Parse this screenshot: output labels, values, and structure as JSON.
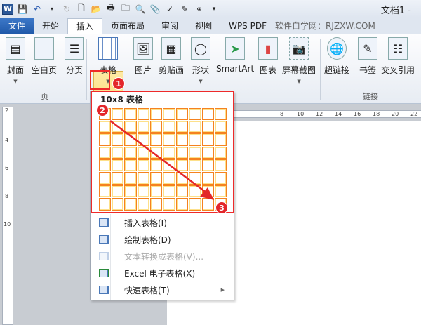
{
  "window": {
    "title": "文档1 -"
  },
  "quick_access": [
    "word-logo",
    "save-icon",
    "undo-icon",
    "redo-icon",
    "new-icon",
    "open-icon",
    "print-icon",
    "folder-icon",
    "preview-icon",
    "attach-icon",
    "spellcheck-icon",
    "edit-icon",
    "org-icon",
    "customize-icon"
  ],
  "tabs": [
    "文件",
    "开始",
    "插入",
    "页面布局",
    "审阅",
    "视图",
    "WPS PDF"
  ],
  "brand_text": "软件自学网：RJZXW.COM",
  "ribbon": {
    "pages": [
      "封面",
      "空白页",
      "分页"
    ],
    "pages_group": "页",
    "table": "表格",
    "illustrations": [
      "图片",
      "剪贴画",
      "形状",
      "SmartArt",
      "图表",
      "屏幕截图"
    ],
    "links": [
      "超链接",
      "书签",
      "交叉引用"
    ],
    "links_group": "链接"
  },
  "dropdown": {
    "grid_title": "10x8 表格",
    "columns": 10,
    "rows": 8,
    "menu": [
      {
        "label": "插入表格(I)",
        "disabled": false
      },
      {
        "label": "绘制表格(D)",
        "disabled": false
      },
      {
        "label": "文本转换成表格(V)...",
        "disabled": true
      },
      {
        "label": "Excel 电子表格(X)",
        "disabled": false
      },
      {
        "label": "快速表格(T)",
        "disabled": false,
        "submenu": true
      }
    ]
  },
  "ruler": {
    "h": [
      "8",
      "10",
      "12",
      "14",
      "16",
      "18",
      "20",
      "22"
    ],
    "v": [
      "2",
      "4",
      "6",
      "8",
      "10"
    ],
    "corner": "L"
  },
  "badges": [
    "1",
    "2",
    "3"
  ],
  "colors": {
    "highlight": "#ee2a2a",
    "file_tab": "#2b5fad",
    "cell": "#f58220"
  }
}
